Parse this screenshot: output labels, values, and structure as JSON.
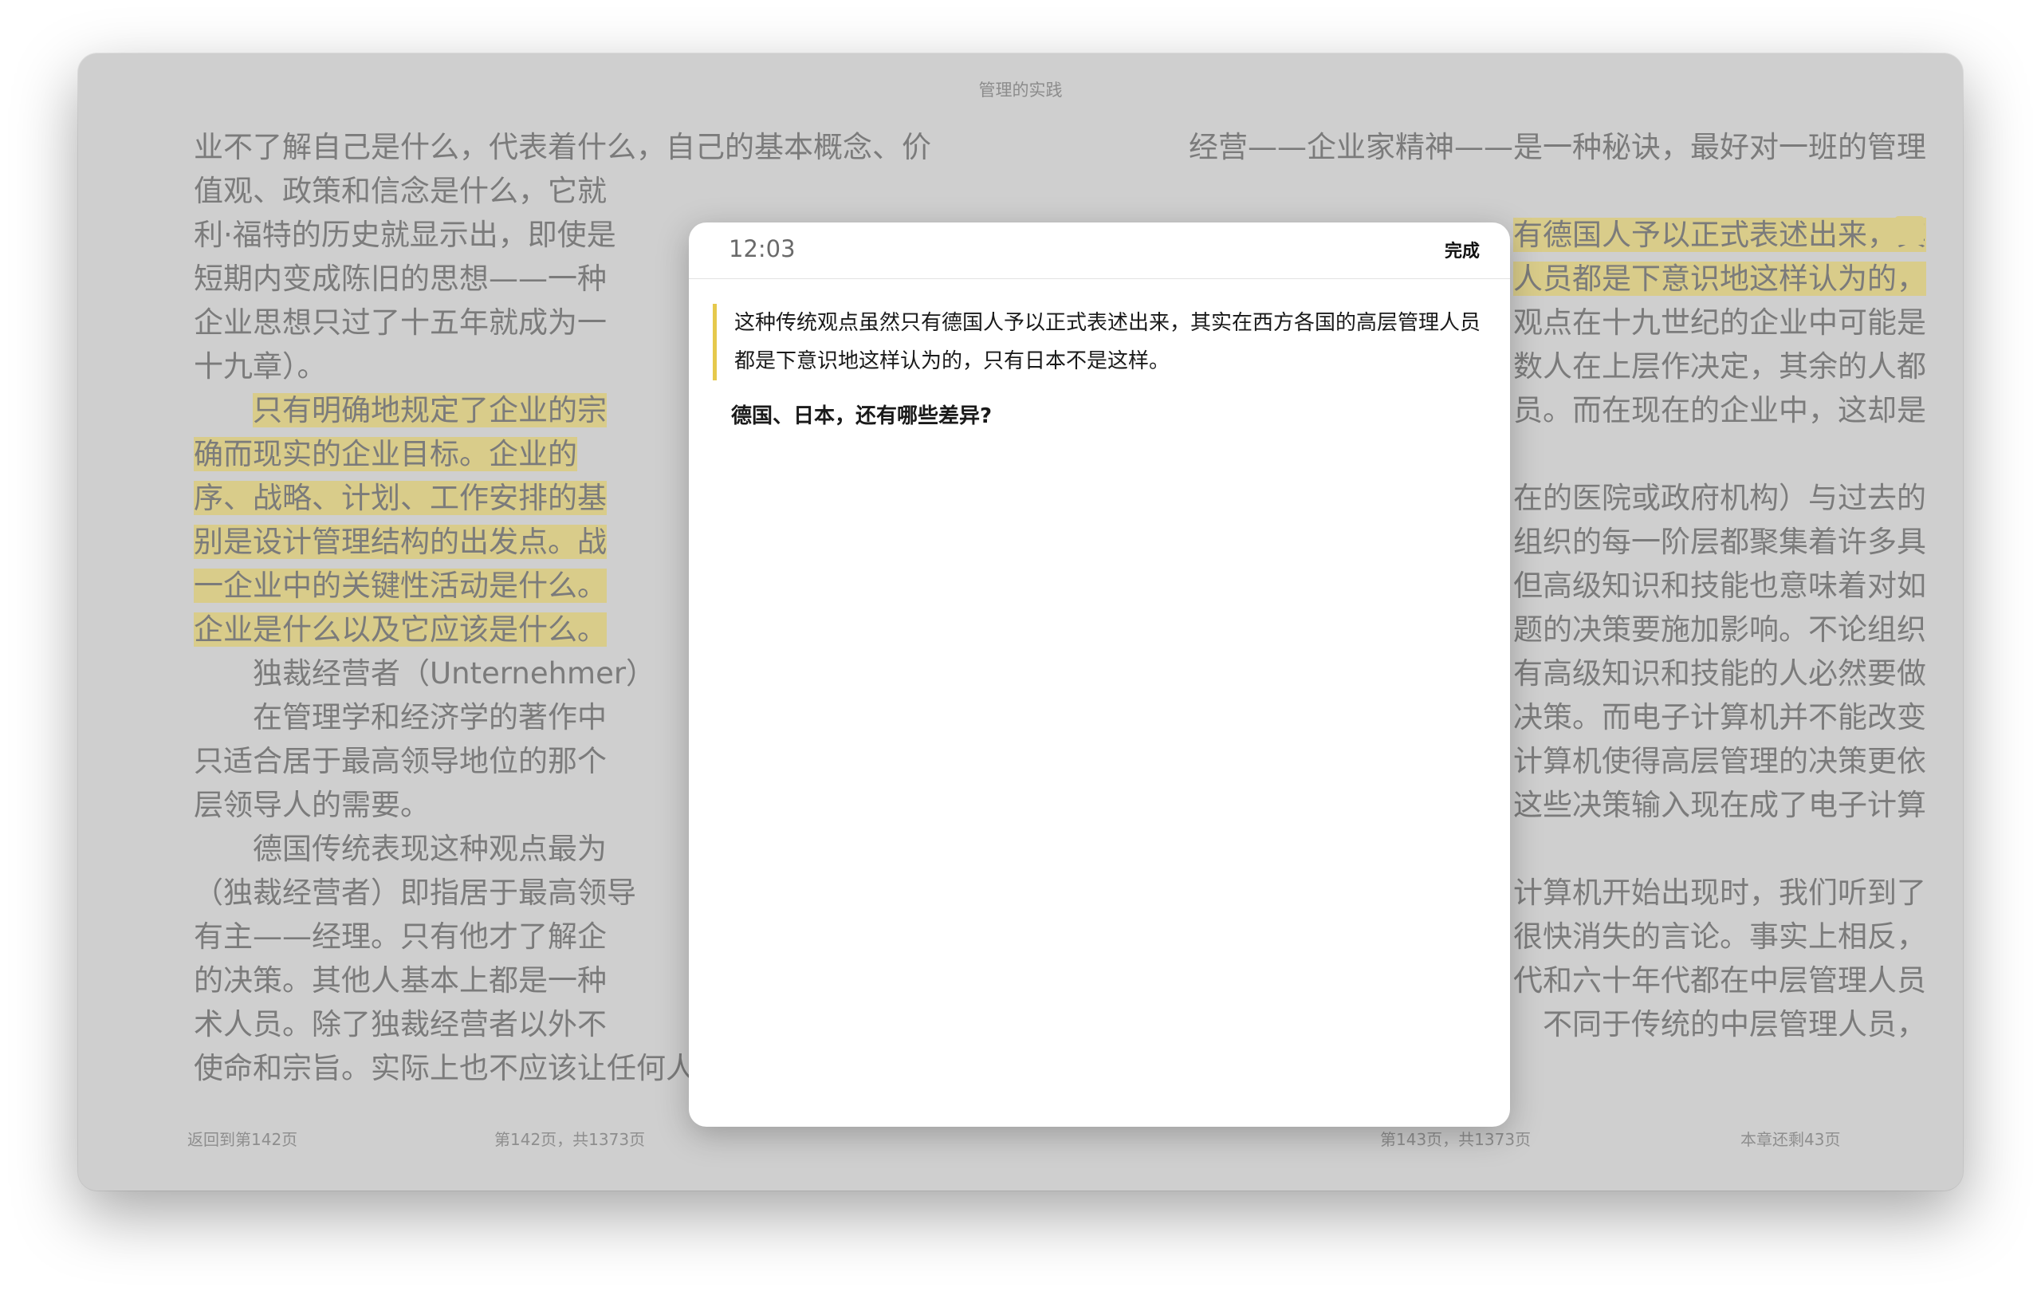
{
  "window": {
    "title": "管理的实践"
  },
  "left_page": {
    "lines": [
      {
        "text": "业不了解自己是什么，代表着什么，自己的基本概念、价",
        "highlight": false,
        "indent": false
      },
      {
        "text": "值观、政策和信念是什么，它就",
        "highlight": false,
        "indent": false
      },
      {
        "text": "利·福特的历史就显示出，即使是",
        "highlight": false,
        "indent": false
      },
      {
        "text": "短期内变成陈旧的思想——一种",
        "highlight": false,
        "indent": false
      },
      {
        "text": "企业思想只过了十五年就成为一",
        "highlight": false,
        "indent": false
      },
      {
        "text": "十九章）。",
        "highlight": false,
        "indent": false
      },
      {
        "text": "只有明确地规定了企业的宗",
        "highlight": true,
        "indent": true
      },
      {
        "text": "确而现实的企业目标。企业的",
        "highlight": true,
        "indent": false
      },
      {
        "text": "序、战略、计划、工作安排的基",
        "highlight": true,
        "indent": false
      },
      {
        "text": "别是设计管理结构的出发点。战",
        "highlight": true,
        "indent": false
      },
      {
        "text": "一企业中的关键性活动是什么。",
        "highlight": true,
        "indent": false
      },
      {
        "text": "企业是什么以及它应该是什么。",
        "highlight": true,
        "indent": false
      },
      {
        "text": "独裁经营者（Unternehmer）",
        "highlight": false,
        "indent": true
      },
      {
        "text": "在管理学和经济学的著作中",
        "highlight": false,
        "indent": true
      },
      {
        "text": "只适合居于最高领导地位的那个",
        "highlight": false,
        "indent": false
      },
      {
        "text": "层领导人的需要。",
        "highlight": false,
        "indent": false
      },
      {
        "text": "德国传统表现这种观点最为",
        "highlight": false,
        "indent": true
      },
      {
        "text": "（独裁经营者）即指居于最高领导",
        "highlight": false,
        "indent": false
      },
      {
        "text": "有主——经理。只有他才了解企",
        "highlight": false,
        "indent": false
      },
      {
        "text": "的决策。其他人基本上都是一种",
        "highlight": false,
        "indent": false
      },
      {
        "text": "术人员。除了独裁经营者以外不",
        "highlight": false,
        "indent": false
      },
      {
        "text": "使命和宗旨。实际上也不应该让任何人知道和了解，独裁",
        "highlight": false,
        "indent": false
      }
    ],
    "footer_back": "返回到第142页",
    "footer_page": "第142页，共1373页"
  },
  "right_page": {
    "lines": [
      {
        "text": "经营——企业家精神——是一种秘诀，最好对一班的管理",
        "highlight": false
      },
      {
        "text": "",
        "highlight": false
      },
      {
        "text": "有德国人予以正式表述出来，其",
        "highlight": true
      },
      {
        "text": "人员都是下意识地这样认为的，",
        "highlight": true
      },
      {
        "text": "观点在十九世纪的企业中可能是",
        "highlight": false
      },
      {
        "text": "数人在上层作决定，其余的人都",
        "highlight": false
      },
      {
        "text": "员。而在现在的企业中，这却是",
        "highlight": false
      },
      {
        "text": "",
        "highlight": false
      },
      {
        "text": "在的医院或政府机构）与过去的",
        "highlight": false
      },
      {
        "text": "组织的每一阶层都聚集着许多具",
        "highlight": false
      },
      {
        "text": "但高级知识和技能也意味着对如",
        "highlight": false
      },
      {
        "text": "题的决策要施加影响。不论组织",
        "highlight": false
      },
      {
        "text": "有高级知识和技能的人必然要做",
        "highlight": false
      },
      {
        "text": "决策。而电子计算机并不能改变",
        "highlight": false
      },
      {
        "text": "计算机使得高层管理的决策更依",
        "highlight": false
      },
      {
        "text": "这些决策输入现在成了电子计算",
        "highlight": false
      },
      {
        "text": "",
        "highlight": false
      },
      {
        "text": "计算机开始出现时，我们听到了",
        "highlight": false
      },
      {
        "text": "很快消失的言论。事实上相反，",
        "highlight": false
      },
      {
        "text": "代和六十年代都在中层管理人员",
        "highlight": false
      },
      {
        "text": "不同于传统的中层管理人员，",
        "highlight": false
      }
    ],
    "footer_page": "第143页，共1373页",
    "footer_remaining": "本章还剩43页"
  },
  "dialog": {
    "time": "12:03",
    "done_label": "完成",
    "quote": "这种传统观点虽然只有德国人予以正式表述出来，其实在西方各国的高层管理人员都是下意识地这样认为的，只有日本不是这样。",
    "note": "德国、日本，还有哪些差异?"
  },
  "colors": {
    "highlight": "#d9cc8a",
    "quote_bar": "#e6c94c",
    "window_bg": "#cfcfcf"
  }
}
